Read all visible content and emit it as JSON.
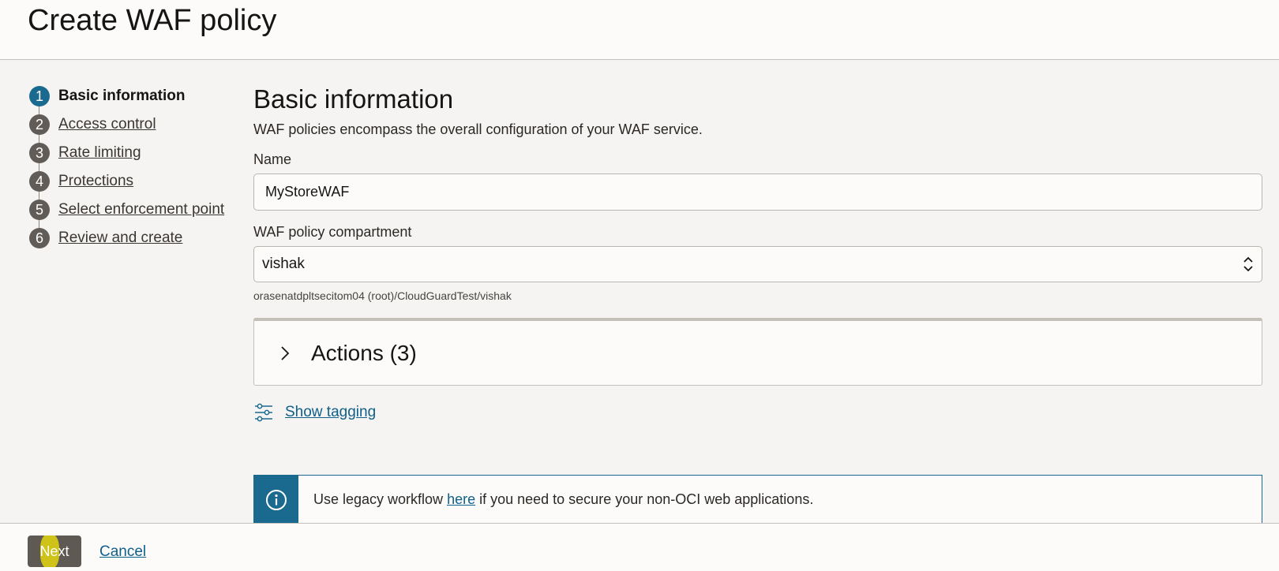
{
  "page": {
    "title": "Create WAF policy"
  },
  "steps": [
    {
      "num": "1",
      "label": "Basic information"
    },
    {
      "num": "2",
      "label": "Access control"
    },
    {
      "num": "3",
      "label": "Rate limiting"
    },
    {
      "num": "4",
      "label": "Protections"
    },
    {
      "num": "5",
      "label": "Select enforcement point"
    },
    {
      "num": "6",
      "label": "Review and create"
    }
  ],
  "form": {
    "section_title": "Basic information",
    "section_desc": "WAF policies encompass the overall configuration of your WAF service.",
    "name_label": "Name",
    "name_value": "MyStoreWAF",
    "compartment_label": "WAF policy compartment",
    "compartment_value": "vishak",
    "compartment_path": "orasenatdpltsecitom04 (root)/CloudGuardTest/vishak",
    "actions_title": "Actions (3)",
    "tagging_link": "Show tagging"
  },
  "banner": {
    "text_before": "Use legacy workflow",
    "link": "here",
    "text_after": "if you need to secure your non-OCI web applications."
  },
  "footer": {
    "next_label": "Next",
    "cancel_label": "Cancel"
  },
  "colors": {
    "accent": "#1a6a8f",
    "link": "#0e5f8a",
    "button": "#5e5953"
  }
}
